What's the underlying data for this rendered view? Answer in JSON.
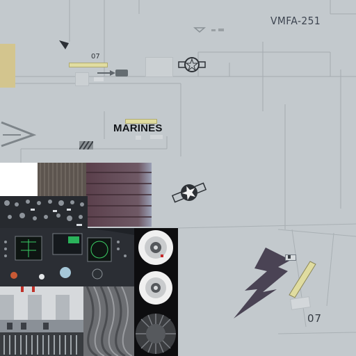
{
  "texture": {
    "squadron_code": "VMFA-251",
    "modex_top": "07",
    "service_label": "MARINES",
    "modex_bottom": "07"
  },
  "colors": {
    "fuselage_grey": "#c3c9cd",
    "panel_line": "#a3aaaf",
    "lightning_bolt": "#4a4354",
    "stencil_yellow": "#d8d59a",
    "cockpit_panel": "#2a2d33"
  },
  "icons": [
    "star-bar-insignia",
    "chevron-marking",
    "lightning-bolt-emblem",
    "wheel-hub",
    "tire-tread"
  ]
}
